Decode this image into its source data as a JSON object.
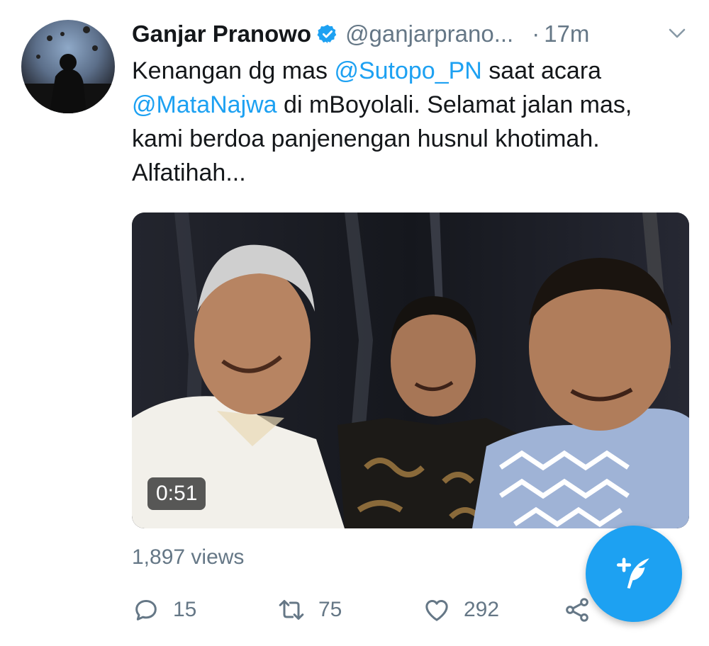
{
  "tweet": {
    "author_name": "Ganjar Pranowo",
    "handle": "@ganjarprano...",
    "separator": "·",
    "time": "17m",
    "text_before": "Kenangan dg mas ",
    "mention1": "@Sutopo_PN",
    "text_middle": " saat acara ",
    "mention2": "@MataNajwa",
    "text_after": " di mBoyolali. Selamat jalan mas, kami berdoa panjenengan husnul khotimah. Alfatihah..."
  },
  "media": {
    "duration": "0:51"
  },
  "stats": {
    "views": "1,897 views",
    "replies": "15",
    "retweets": "75",
    "likes": "292"
  },
  "icons": {
    "verified": "verified-badge-icon",
    "menu": "chevron-down-icon",
    "reply": "reply-icon",
    "retweet": "retweet-icon",
    "like": "heart-icon",
    "share": "share-icon",
    "compose": "compose-tweet-icon"
  },
  "colors": {
    "accent": "#1da1f2",
    "muted": "#657786",
    "text": "#14171a"
  }
}
